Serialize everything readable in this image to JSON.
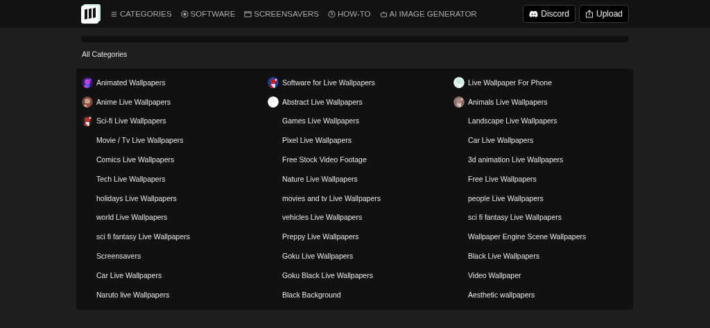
{
  "nav": {
    "items": [
      {
        "kind": "menu",
        "label": "CATEGORIES"
      },
      {
        "kind": "software",
        "label": "SOFTWARE"
      },
      {
        "kind": "window",
        "label": "SCREENSAVERS"
      },
      {
        "kind": "help",
        "label": "HOW-TO"
      },
      {
        "kind": "robot",
        "label": "AI IMAGE GENERATOR"
      }
    ],
    "buttons": [
      {
        "kind": "discord",
        "label": "Discord"
      },
      {
        "kind": "upload",
        "label": "Upload"
      }
    ]
  },
  "heading": "All Categories",
  "columns": [
    [
      {
        "label": "Animated Wallpapers",
        "kind": "picture"
      },
      {
        "label": "Anime Live Wallpapers",
        "kind": "picture"
      },
      {
        "label": "Sci-fi Live Wallpapers",
        "kind": "picture"
      },
      {
        "label": "Movie / Tv Live Wallpapers",
        "kind": "plain"
      },
      {
        "label": "Comics Live Wallpapers",
        "kind": "plain"
      },
      {
        "label": "Tech Live Wallpapers",
        "kind": "plain"
      },
      {
        "label": "holidays Live Wallpapers",
        "kind": "plain"
      },
      {
        "label": "world Live Wallpapers",
        "kind": "plain"
      },
      {
        "label": "sci fi fantasy Live Wallpapers",
        "kind": "plain"
      },
      {
        "label": "Screensavers",
        "kind": "plain"
      },
      {
        "label": "Car Live Wallpapers",
        "kind": "plain"
      },
      {
        "label": "Naruto live Wallpapers",
        "kind": "plain"
      }
    ],
    [
      {
        "label": "Software for Live Wallpapers",
        "kind": "picture"
      },
      {
        "label": "Abstract Live Wallpapers",
        "kind": "picture"
      },
      {
        "label": "Games Live Wallpapers",
        "kind": "plain"
      },
      {
        "label": "Pixel Live Wallpapers",
        "kind": "plain"
      },
      {
        "label": "Free Stock Video Footage",
        "kind": "plain"
      },
      {
        "label": "Nature Live Wallpapers",
        "kind": "plain"
      },
      {
        "label": "movies and tv Live Wallpapers",
        "kind": "plain"
      },
      {
        "label": "vehicles Live Wallpapers",
        "kind": "plain"
      },
      {
        "label": "Preppy Live Wallpapers",
        "kind": "plain"
      },
      {
        "label": "Goku Live Wallpapers",
        "kind": "plain"
      },
      {
        "label": "Goku Black Live Wallpapers",
        "kind": "plain"
      },
      {
        "label": "Black Background",
        "kind": "plain"
      }
    ],
    [
      {
        "label": "Live Wallpaper For Phone",
        "kind": "picture"
      },
      {
        "label": "Animals Live Wallpapers",
        "kind": "picture"
      },
      {
        "label": "Landscape Live Wallpapers",
        "kind": "plain"
      },
      {
        "label": "Car Live Wallpapers",
        "kind": "plain"
      },
      {
        "label": "3d animation Live Wallpapers",
        "kind": "plain"
      },
      {
        "label": "Free Live Wallpapers",
        "kind": "plain"
      },
      {
        "label": "people Live Wallpapers",
        "kind": "plain"
      },
      {
        "label": "sci fi fantasy Live Wallpapers",
        "kind": "plain"
      },
      {
        "label": "Wallpaper Engine Scene Wallpapers",
        "kind": "plain"
      },
      {
        "label": "Black Live Wallpapers",
        "kind": "plain"
      },
      {
        "label": "Video Wallpaper",
        "kind": "plain"
      },
      {
        "label": "Aesthetic wallpapers",
        "kind": "plain"
      }
    ]
  ]
}
